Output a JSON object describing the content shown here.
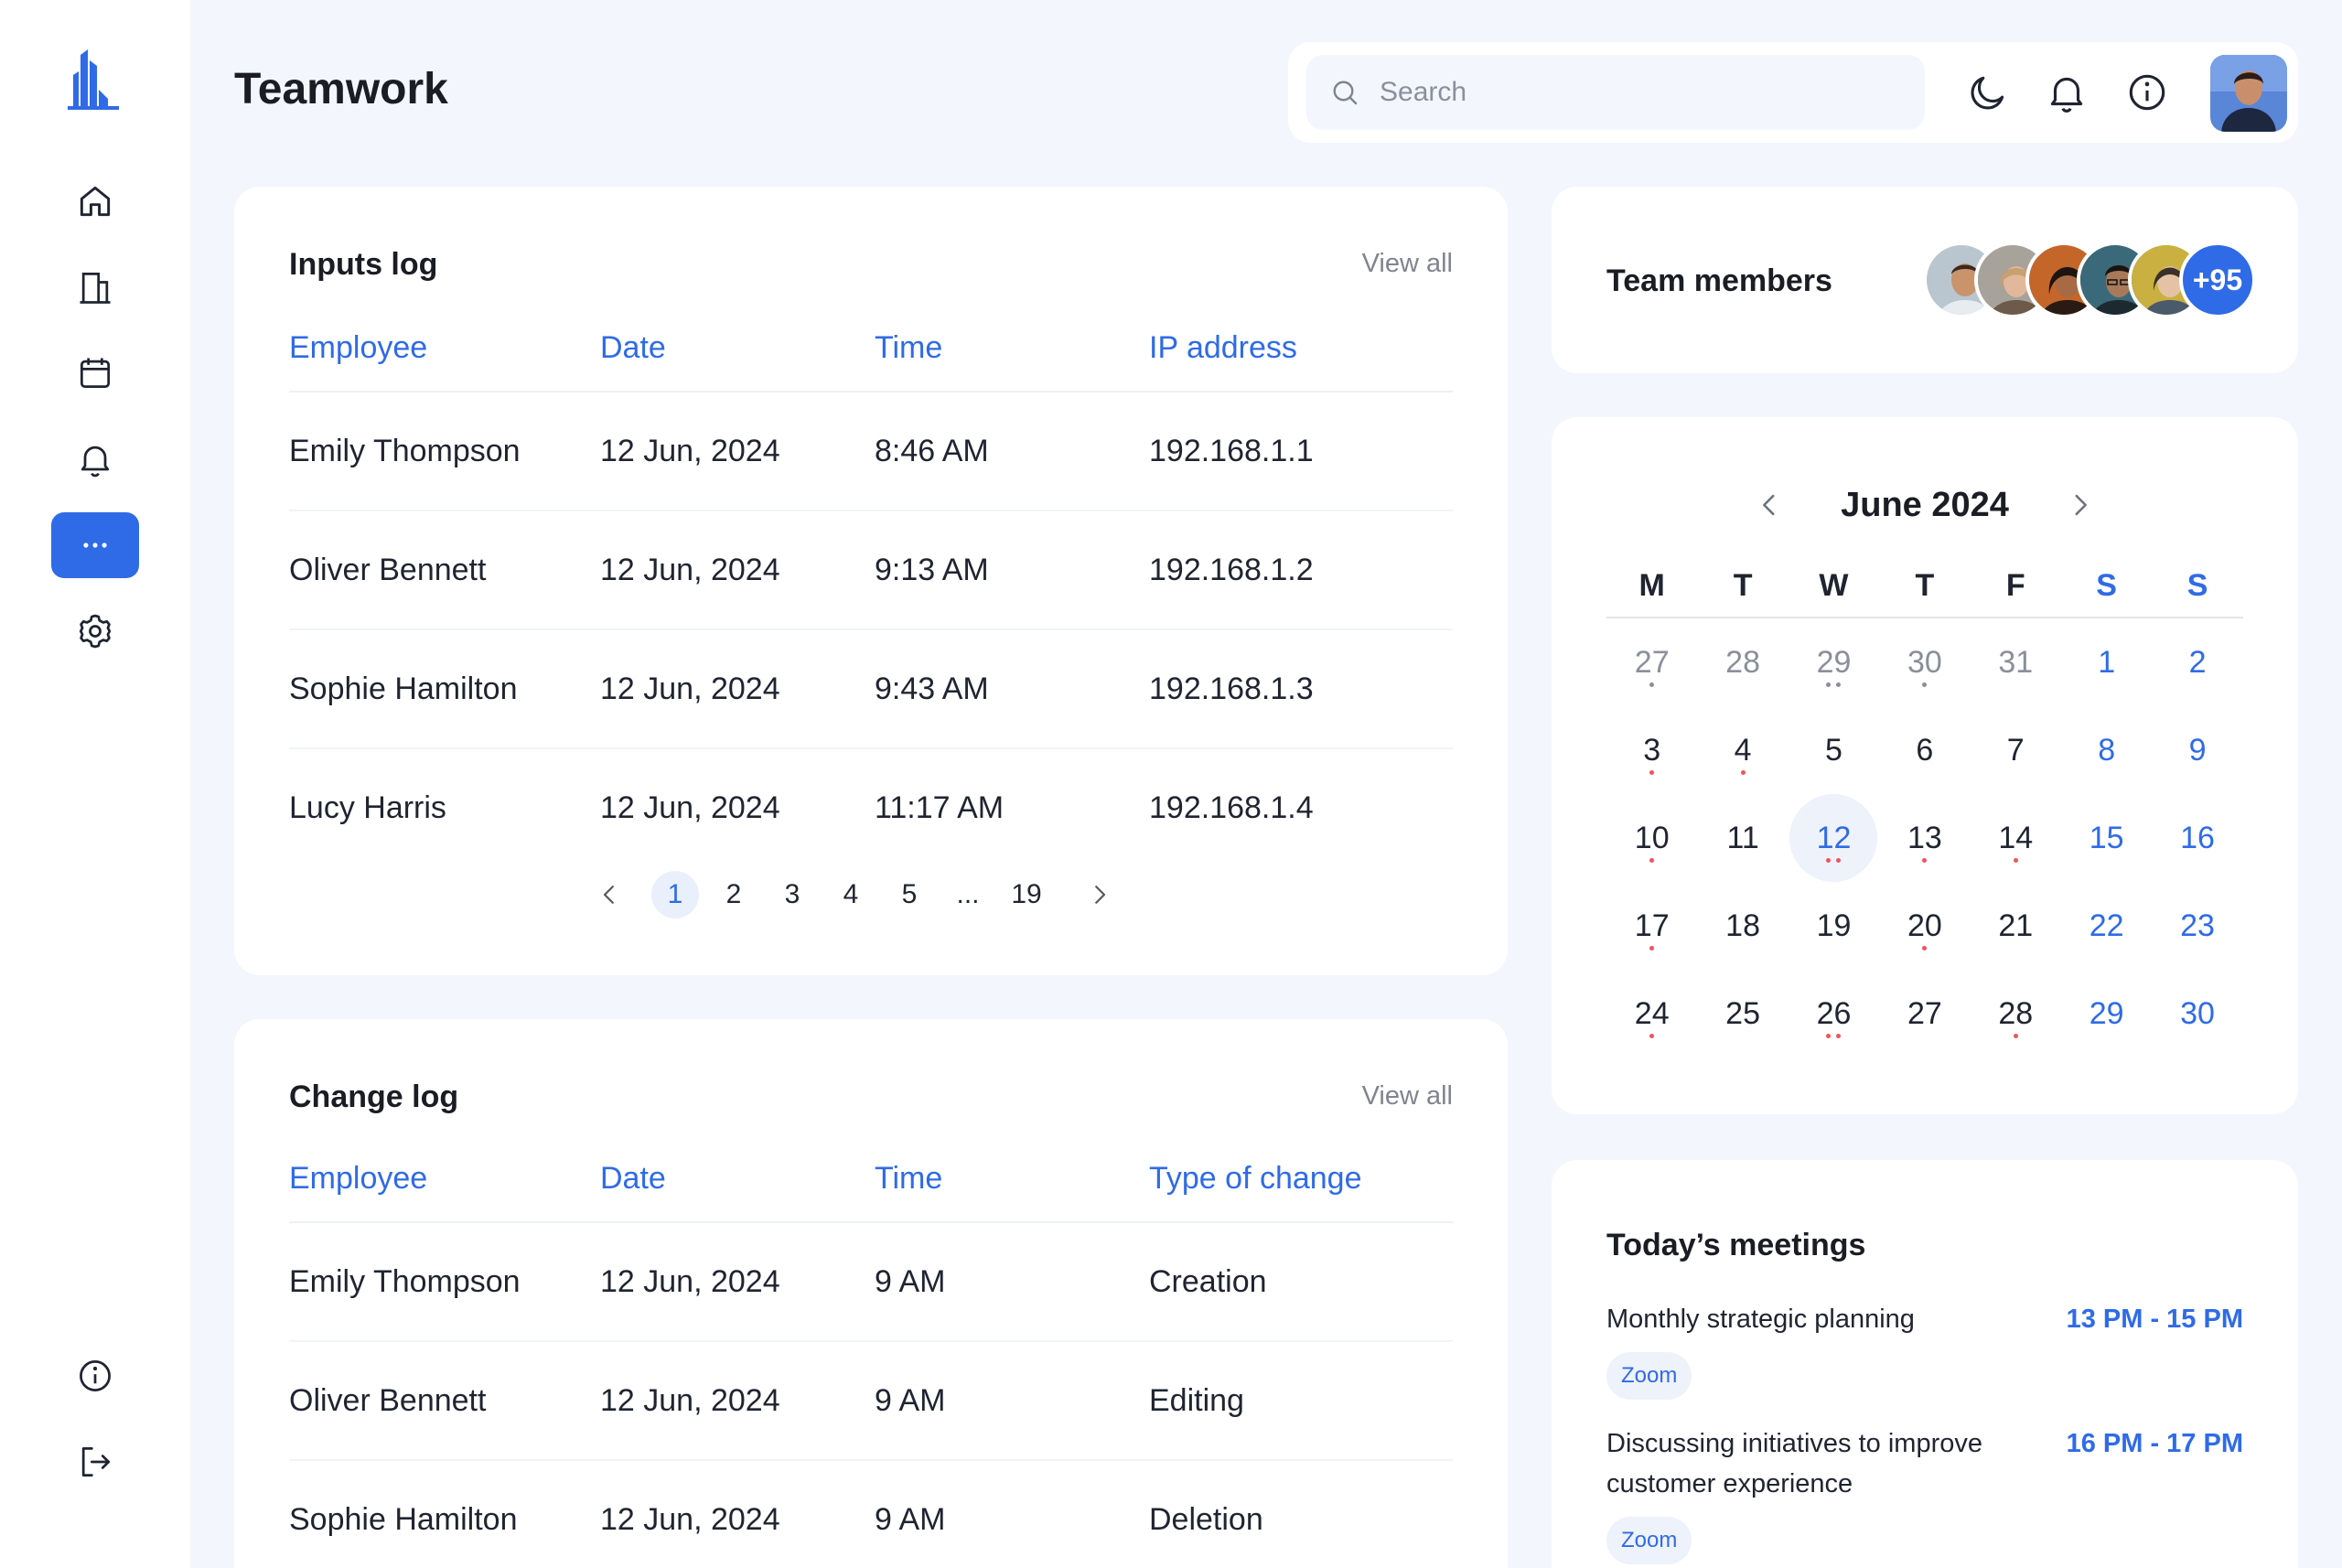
{
  "header": {
    "title": "Teamwork",
    "search_placeholder": "Search"
  },
  "sidebar": {
    "items": [
      {
        "name": "home-icon"
      },
      {
        "name": "building-icon"
      },
      {
        "name": "calendar-icon"
      },
      {
        "name": "bell-icon"
      },
      {
        "name": "more-icon",
        "active": true
      },
      {
        "name": "gear-icon"
      }
    ],
    "bottom": [
      {
        "name": "info-icon"
      },
      {
        "name": "logout-icon"
      }
    ]
  },
  "colors": {
    "accent": "#2f6be6",
    "background": "#f3f6fd",
    "event_dot": "#f0535b"
  },
  "inputs_log": {
    "title": "Inputs log",
    "view_all": "View all",
    "columns": [
      "Employee",
      "Date",
      "Time",
      "IP address"
    ],
    "rows": [
      [
        "Emily Thompson",
        "12 Jun, 2024",
        "8:46 AM",
        "192.168.1.1"
      ],
      [
        "Oliver Bennett",
        "12 Jun, 2024",
        "9:13 AM",
        "192.168.1.2"
      ],
      [
        "Sophie Hamilton",
        "12 Jun, 2024",
        "9:43 AM",
        "192.168.1.3"
      ],
      [
        "Lucy Harris",
        "12 Jun, 2024",
        "11:17 AM",
        "192.168.1.4"
      ]
    ],
    "pagination": {
      "pages": [
        "1",
        "2",
        "3",
        "4",
        "5",
        "...",
        "19"
      ],
      "current": "1"
    }
  },
  "change_log": {
    "title": "Change log",
    "view_all": "View all",
    "columns": [
      "Employee",
      "Date",
      "Time",
      "Type of change"
    ],
    "rows": [
      [
        "Emily Thompson",
        "12 Jun, 2024",
        "9 AM",
        "Creation"
      ],
      [
        "Oliver Bennett",
        "12 Jun, 2024",
        "9 AM",
        "Editing"
      ],
      [
        "Sophie Hamilton",
        "12 Jun, 2024",
        "9 AM",
        "Deletion"
      ]
    ]
  },
  "team": {
    "title": "Team members",
    "more_count": "+95"
  },
  "calendar": {
    "month_label": "June 2024",
    "weekdays": [
      "M",
      "T",
      "W",
      "T",
      "F",
      "S",
      "S"
    ],
    "weeks": [
      [
        {
          "d": "27",
          "muted": true,
          "dots": [
            "gray"
          ]
        },
        {
          "d": "28",
          "muted": true
        },
        {
          "d": "29",
          "muted": true,
          "dots": [
            "gray",
            "gray"
          ]
        },
        {
          "d": "30",
          "muted": true,
          "dots": [
            "gray"
          ]
        },
        {
          "d": "31",
          "muted": true
        },
        {
          "d": "1"
        },
        {
          "d": "2"
        }
      ],
      [
        {
          "d": "3",
          "dots": [
            "red"
          ]
        },
        {
          "d": "4",
          "dots": [
            "red"
          ]
        },
        {
          "d": "5"
        },
        {
          "d": "6"
        },
        {
          "d": "7"
        },
        {
          "d": "8"
        },
        {
          "d": "9"
        }
      ],
      [
        {
          "d": "10",
          "dots": [
            "red"
          ]
        },
        {
          "d": "11"
        },
        {
          "d": "12",
          "today": true,
          "dots": [
            "red",
            "red"
          ]
        },
        {
          "d": "13",
          "dots": [
            "red"
          ]
        },
        {
          "d": "14",
          "dots": [
            "red"
          ]
        },
        {
          "d": "15"
        },
        {
          "d": "16"
        }
      ],
      [
        {
          "d": "17",
          "dots": [
            "red"
          ]
        },
        {
          "d": "18"
        },
        {
          "d": "19"
        },
        {
          "d": "20",
          "dots": [
            "red"
          ]
        },
        {
          "d": "21"
        },
        {
          "d": "22"
        },
        {
          "d": "23"
        }
      ],
      [
        {
          "d": "24",
          "dots": [
            "red"
          ]
        },
        {
          "d": "25"
        },
        {
          "d": "26",
          "dots": [
            "red",
            "red"
          ]
        },
        {
          "d": "27"
        },
        {
          "d": "28",
          "dots": [
            "red"
          ]
        },
        {
          "d": "29"
        },
        {
          "d": "30"
        }
      ]
    ]
  },
  "meetings": {
    "title": "Today’s meetings",
    "items": [
      {
        "title": "Monthly strategic planning",
        "time": "13 PM - 15 PM",
        "tag": "Zoom"
      },
      {
        "title": "Discussing initiatives to improve customer experience",
        "time": "16 PM - 17 PM",
        "tag": "Zoom"
      }
    ]
  }
}
